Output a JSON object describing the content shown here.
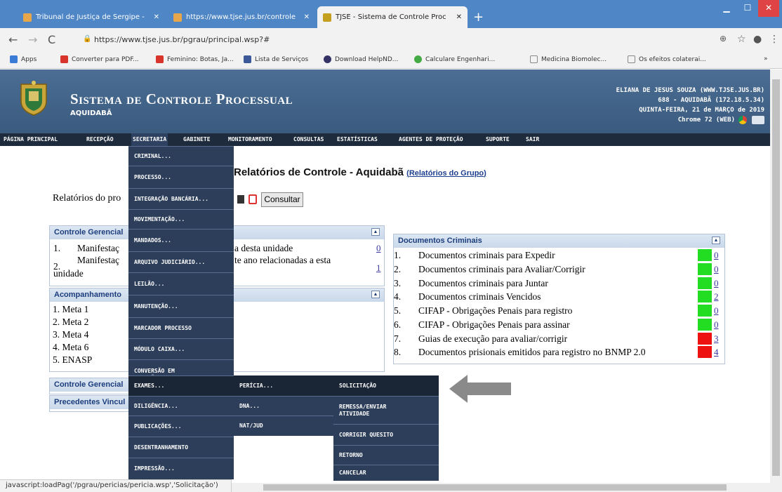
{
  "browser": {
    "tabs": [
      {
        "title": "Tribunal de Justiça de Sergipe -",
        "icon_color": "#e8a64b"
      },
      {
        "title": "https://www.tjse.jus.br/controle",
        "icon_color": "#e8a64b"
      },
      {
        "title": "TJSE - Sistema de Controle Proc",
        "icon_color": "#c4a020"
      }
    ],
    "new_tab": "+",
    "url": "https://www.tjse.jus.br/pgrau/principal.wsp?#",
    "bookmarks": [
      {
        "label": "Apps",
        "color": "#3a7bd5"
      },
      {
        "label": "Converter para PDF...",
        "color": "#d9342b"
      },
      {
        "label": "Feminino: Botas, Ja...",
        "color": "#d9342b"
      },
      {
        "label": "Lista de Serviços",
        "color": "#3b5998"
      },
      {
        "label": "Download HelpND...",
        "color": "#333366"
      },
      {
        "label": "Calculare Engenhari...",
        "color": "#44aa44"
      },
      {
        "label": "Medicina Biomolec...",
        "color": "#888888"
      },
      {
        "label": "Os efeitos colaterai...",
        "color": "#888888"
      }
    ]
  },
  "header": {
    "title": "Sistema de Controle Processual",
    "comarca": "AQUIDABÃ",
    "user_lines": [
      "ELIANA DE JESUS SOUZA (WWW.TJSE.JUS.BR)",
      "688 - AQUIDABÃ (172.18.5.34)",
      "QUINTA-FEIRA, 21 de MARÇO de 2019",
      "Chrome 72 (WEB)"
    ]
  },
  "menu": [
    "PÁGINA PRINCIPAL",
    "RECEPÇÃO",
    "SECRETARIA",
    "GABINETE",
    "MONITORAMENTO",
    "CONSULTAS",
    "ESTATÍSTICAS",
    "AGENTES DE PROTEÇÃO",
    "SUPORTE",
    "SAIR"
  ],
  "secretaria_menu": [
    "CRIMINAL...",
    "PROCESSO...",
    "INTEGRAÇÃO BANCÁRIA...",
    "MOVIMENTAÇÃO...",
    "MANDADOS...",
    "ARQUIVO JUDICIÁRIO...",
    "LEILÃO...",
    "MANUTENÇÃO...",
    "MARCADOR PROCESSO",
    "MÓDULO CAIXA...",
    "CONVERSÃO EM ELETRÔNICO",
    "EXAMES...",
    "DILIGÊNCIA...",
    "PUBLICAÇÕES...",
    "DESENTRANHAMENTO",
    "IMPRESSÃO..."
  ],
  "exames_menu": [
    "PERÍCIA...",
    "DNA...",
    "NAT/JUD"
  ],
  "pericia_menu": [
    "SOLICITAÇÃO",
    "REMESSA/ENVIAR ATIVIDADE",
    "CORRIGIR QUESITO",
    "RETORNO",
    "CANCELAR"
  ],
  "page": {
    "title": "Relatórios de Controle - Aquidabã",
    "group_link": "Relatórios do Grupo",
    "reports_label": "Relatórios do pro",
    "consult_button": "Consultar"
  },
  "panel_gerencial": {
    "header": "Controle Gerencial",
    "items": [
      {
        "num": "1.",
        "left": "Manifestaç",
        "right": "a desta unidade",
        "count": "0"
      },
      {
        "num": "2.",
        "left": "Manifestaç",
        "right": "te ano relacionadas a esta",
        "left2": "unidade",
        "count": "1"
      }
    ]
  },
  "panel_metas": {
    "header": "Acompanhamento",
    "items": [
      "1. Meta 1",
      "2. Meta 2",
      "3. Meta 4",
      "4. Meta 6",
      "5. ENASP"
    ]
  },
  "panel_gerencial2": {
    "header": "Controle Gerencial"
  },
  "panel_precedentes": {
    "header": "Precedentes Vincul"
  },
  "panel_criminais": {
    "header": "Documentos Criminais",
    "items": [
      {
        "num": "1.",
        "label": "Documentos criminais para Expedir",
        "count": "0",
        "status_color": "#22dd22"
      },
      {
        "num": "2.",
        "label": "Documentos criminais para Avaliar/Corrigir",
        "count": "0",
        "status_color": "#22dd22"
      },
      {
        "num": "3.",
        "label": "Documentos criminais para Juntar",
        "count": "0",
        "status_color": "#22dd22"
      },
      {
        "num": "4.",
        "label": "Documentos criminais Vencidos",
        "count": "2",
        "status_color": "#22dd22"
      },
      {
        "num": "5.",
        "label": "CIFAP - Obrigações Penais para registro",
        "count": "0",
        "status_color": "#22dd22"
      },
      {
        "num": "6.",
        "label": "CIFAP - Obrigações Penais para assinar",
        "count": "0",
        "status_color": "#22dd22"
      },
      {
        "num": "7.",
        "label": "Guias de execução para avaliar/corrigir",
        "count": "3",
        "status_color": "#ee1111"
      },
      {
        "num": "8.",
        "label": "Documentos prisionais emitidos para registro no BNMP 2.0",
        "count": "4",
        "status_color": "#ee1111"
      }
    ]
  },
  "status_text": "javascript:loadPag('/pgrau/pericias/pericia.wsp','Solicitação')"
}
